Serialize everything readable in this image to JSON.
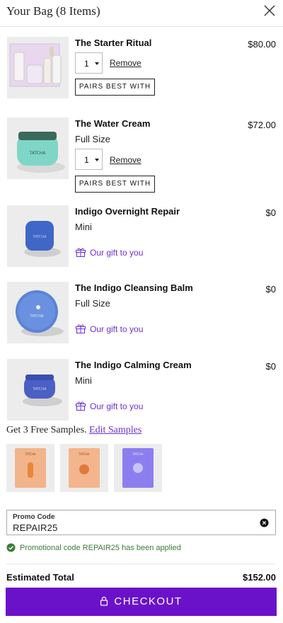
{
  "header": {
    "title": "Your Bag (8 Items)"
  },
  "items": [
    {
      "name": "The Starter Ritual",
      "price": "$80.00",
      "quantity": "1",
      "remove_label": "Remove",
      "pairs_label": "PAIRS BEST WITH",
      "image": "starter-ritual-set"
    },
    {
      "name": "The Water Cream",
      "price": "$72.00",
      "size": "Full Size",
      "quantity": "1",
      "remove_label": "Remove",
      "pairs_label": "PAIRS BEST WITH",
      "image": "water-cream-jar"
    },
    {
      "name": "Indigo Overnight Repair",
      "price": "$0",
      "size": "Mini",
      "gift_label": "Our gift to you",
      "image": "indigo-overnight-repair-jar"
    },
    {
      "name": "The Indigo Cleansing Balm",
      "price": "$0",
      "size": "Full Size",
      "gift_label": "Our gift to you",
      "image": "indigo-cleansing-balm"
    },
    {
      "name": "The Indigo Calming Cream",
      "price": "$0",
      "size": "Mini",
      "gift_label": "Our gift to you",
      "image": "indigo-calming-cream"
    }
  ],
  "samples": {
    "text": "Get 3 Free Samples.",
    "edit_label": "Edit Samples",
    "items": [
      {
        "image": "orange-sample-packet"
      },
      {
        "image": "peach-sample-packet"
      },
      {
        "image": "purple-sample-packet"
      }
    ]
  },
  "promo": {
    "label": "Promo Code",
    "value": "REPAIR25",
    "message": "Promotional code REPAIR25 has been applied"
  },
  "totals": {
    "label": "Estimated Total",
    "value": "$152.00"
  },
  "checkout": {
    "label": "CHECKOUT"
  },
  "colors": {
    "accent": "#6a12c9",
    "gift": "#6e2fd6",
    "success": "#3e7a3a"
  }
}
